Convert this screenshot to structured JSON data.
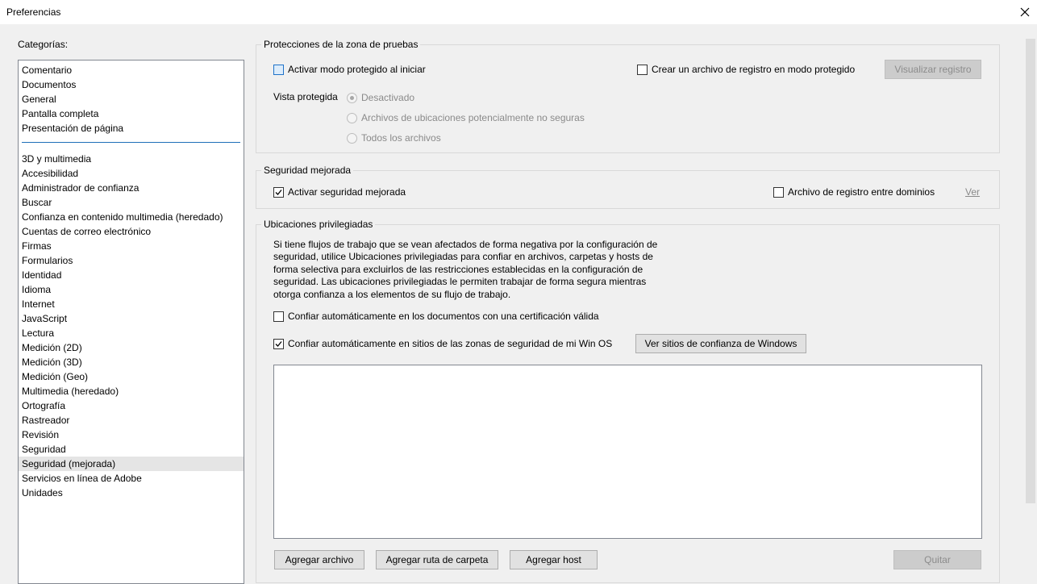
{
  "window": {
    "title": "Preferencias"
  },
  "categories": {
    "label": "Categorías:",
    "top_items": [
      "Comentario",
      "Documentos",
      "General",
      "Pantalla completa",
      "Presentación de página"
    ],
    "items": [
      "3D y multimedia",
      "Accesibilidad",
      "Administrador de confianza",
      "Buscar",
      "Confianza en contenido multimedia (heredado)",
      "Cuentas de correo electrónico",
      "Firmas",
      "Formularios",
      "Identidad",
      "Idioma",
      "Internet",
      "JavaScript",
      "Lectura",
      "Medición (2D)",
      "Medición (3D)",
      "Medición (Geo)",
      "Multimedia (heredado)",
      "Ortografía",
      "Rastreador",
      "Revisión",
      "Seguridad",
      "Seguridad (mejorada)",
      "Servicios en línea de Adobe",
      "Unidades"
    ],
    "selected": "Seguridad (mejorada)"
  },
  "sandbox": {
    "title": "Protecciones de la zona de pruebas",
    "protected_mode": {
      "label": "Activar modo protegido al iniciar",
      "checked": false
    },
    "log_file": {
      "label": "Crear un archivo de registro en modo protegido",
      "checked": false
    },
    "view_log_button": "Visualizar registro",
    "protected_view_label": "Vista protegida",
    "protected_view_options": [
      "Desactivado",
      "Archivos de ubicaciones potencialmente no seguras",
      "Todos los archivos"
    ],
    "protected_view_selected": 0
  },
  "enhanced": {
    "title": "Seguridad mejorada",
    "enable": {
      "label": "Activar seguridad mejorada",
      "checked": true
    },
    "cross_domain": {
      "label": "Archivo de registro entre dominios",
      "checked": false
    },
    "view_link": "Ver"
  },
  "privileged": {
    "title": "Ubicaciones privilegiadas",
    "description_lines": [
      "Si tiene flujos de trabajo que se vean afectados de forma negativa por la configuración de",
      "seguridad, utilice Ubicaciones privilegiadas para confiar en archivos, carpetas y hosts de",
      "forma selectiva para excluirlos de las restricciones establecidas en la configuración de",
      "seguridad. Las ubicaciones privilegiadas le permiten trabajar de forma segura mientras",
      "otorga confianza a los elementos de su flujo de trabajo."
    ],
    "trust_certified": {
      "label": "Confiar automáticamente en los documentos con una certificación válida",
      "checked": false
    },
    "trust_win_zones": {
      "label": "Confiar automáticamente en sitios de las zonas de seguridad de mi Win OS",
      "checked": true
    },
    "view_windows_sites_button": "Ver sitios de confianza de Windows",
    "add_file_button": "Agregar archivo",
    "add_folder_button": "Agregar ruta de carpeta",
    "add_host_button": "Agregar host",
    "remove_button": "Quitar"
  }
}
